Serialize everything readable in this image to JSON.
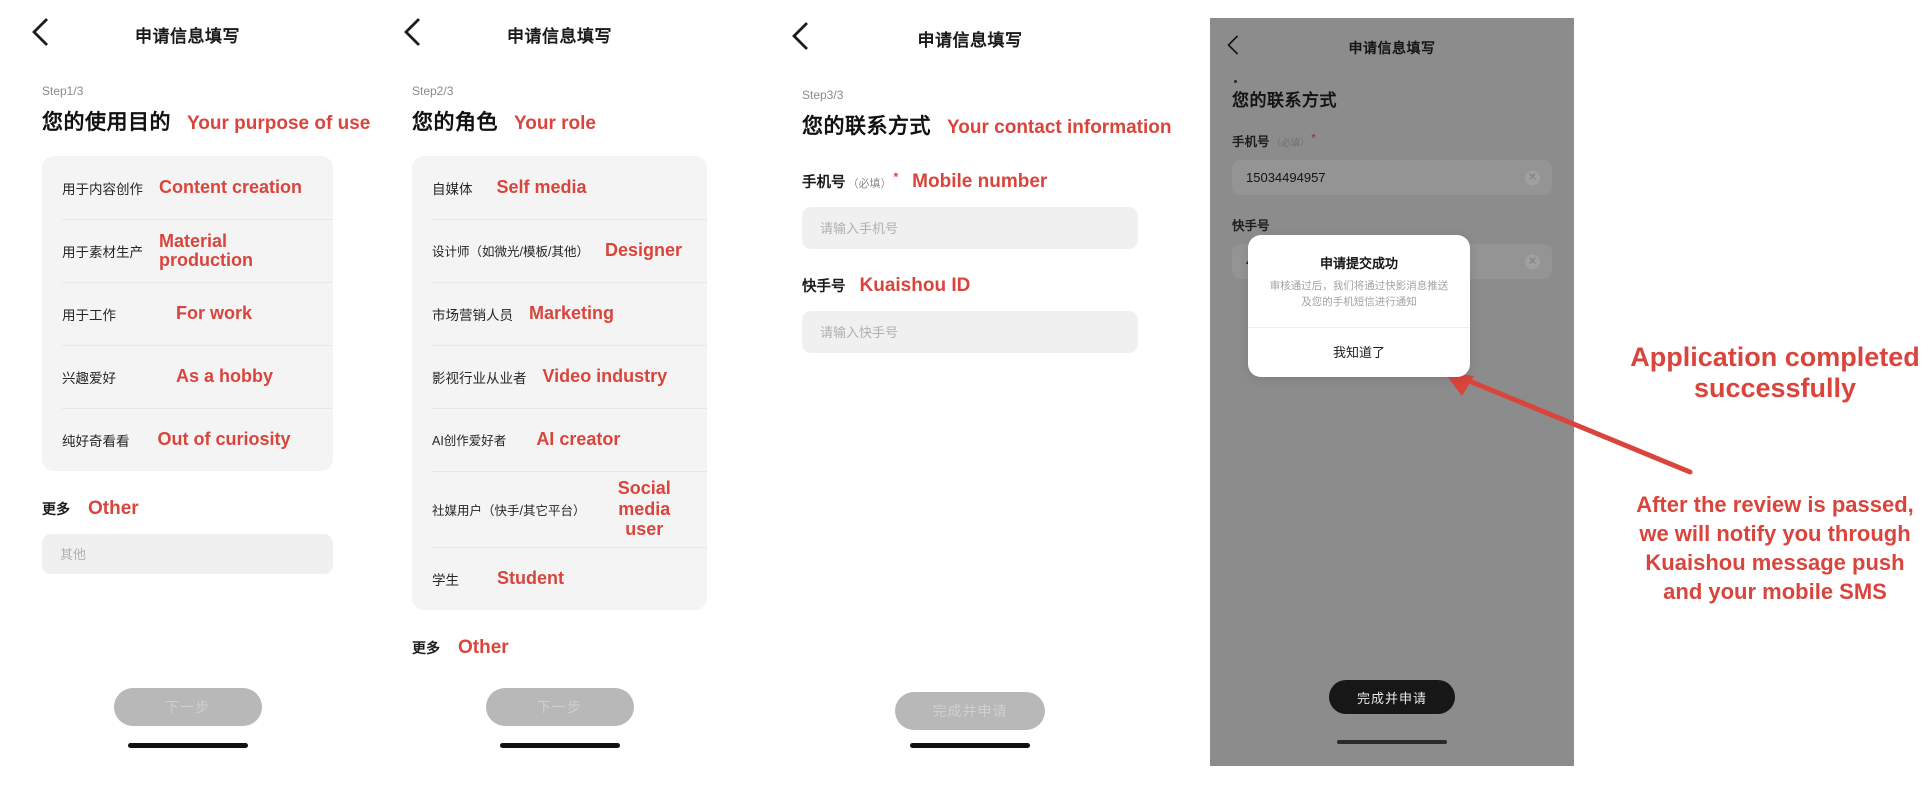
{
  "nav": {
    "title": "申请信息填写",
    "back_icon": "chevron-left-icon"
  },
  "panel1": {
    "step": "Step1/3",
    "section_title_zh": "您的使用目的",
    "section_title_en": "Your purpose of use",
    "options": [
      {
        "zh": "用于内容创作",
        "en": "Content creation"
      },
      {
        "zh": "用于素材生产",
        "en": "Material production"
      },
      {
        "zh": "用于工作",
        "en": "For work"
      },
      {
        "zh": "兴趣爱好",
        "en": "As a hobby"
      },
      {
        "zh": "纯好奇看看",
        "en": "Out of curiosity"
      }
    ],
    "more_zh": "更多",
    "more_en": "Other",
    "other_placeholder": "其他",
    "cta": "下一步"
  },
  "panel2": {
    "step": "Step2/3",
    "section_title_zh": "您的角色",
    "section_title_en": "Your role",
    "options": [
      {
        "zh": "自媒体",
        "en": "Self media"
      },
      {
        "zh": "设计师（如微光/模板/其他）",
        "en": "Designer"
      },
      {
        "zh": "市场营销人员",
        "en": "Marketing"
      },
      {
        "zh": "影视行业从业者",
        "en": "Video industry"
      },
      {
        "zh": "AI创作爱好者",
        "en": "AI creator"
      },
      {
        "zh": "社媒用户（快手/其它平台）",
        "en": "Social media user"
      },
      {
        "zh": "学生",
        "en": "Student"
      }
    ],
    "more_zh": "更多",
    "more_en": "Other",
    "cta": "下一步"
  },
  "panel3": {
    "step": "Step3/3",
    "section_title_zh": "您的联系方式",
    "section_title_en": "Your contact information",
    "phone_label_zh": "手机号",
    "phone_label_req": "（必填）",
    "phone_label_star": "*",
    "phone_label_en": "Mobile number",
    "phone_placeholder": "请输入手机号",
    "kuaishou_label_zh": "快手号",
    "kuaishou_label_en": "Kuaishou ID",
    "kuaishou_placeholder": "请输入快手号",
    "cta": "完成并申请"
  },
  "panel4": {
    "nav_title": "申请信息填写",
    "heading": "您的联系方式",
    "phone_label_zh": "手机号",
    "phone_label_req": "（必填）",
    "phone_label_star": "*",
    "phone_value": "15034494957",
    "kuaishou_label_zh": "快手号",
    "kuaishou_value": "417",
    "clear_icon": "clear-circle-icon",
    "cta": "完成并申请",
    "modal": {
      "title": "申请提交成功",
      "body_line1": "审核通过后，我们将通过快影消息推送",
      "body_line2": "及您的手机短信进行通知",
      "action": "我知道了"
    }
  },
  "annotation": {
    "success": "Application completed successfully",
    "detail": "After the review is passed, we will notify you through Kuaishou message push and your mobile SMS",
    "arrow_icon": "arrow-pointer-icon"
  },
  "colors": {
    "accent_red": "#d9453c",
    "card_grey": "#f4f4f4",
    "disabled_grey": "#b8b8b8",
    "overlay_grey": "#8c8c8c"
  }
}
